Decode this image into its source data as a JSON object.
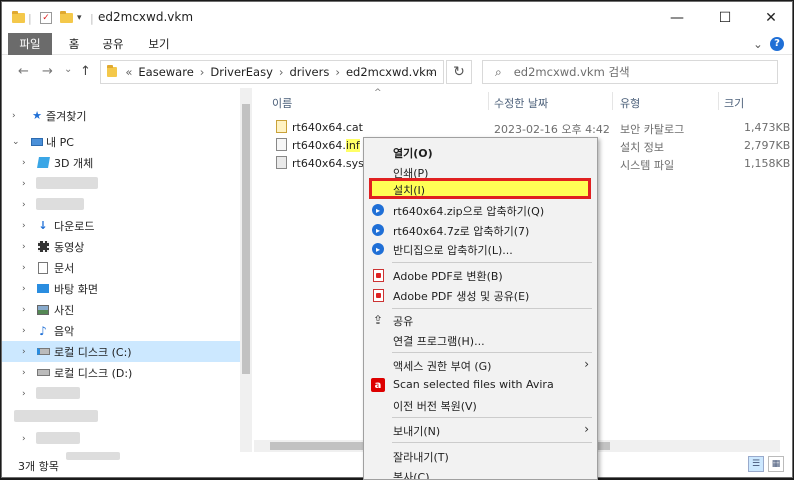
{
  "window": {
    "title": "ed2mcxwd.vkm",
    "minimize": "—",
    "maximize": "☐",
    "close": "✕",
    "help": "?"
  },
  "ribbon": {
    "tabs": [
      {
        "label": "파일"
      },
      {
        "label": "홈"
      },
      {
        "label": "공유"
      },
      {
        "label": "보기"
      }
    ],
    "expand": "⌄"
  },
  "nav": {
    "back": "←",
    "forward": "→",
    "recent": "⌄",
    "up": "↑",
    "breadcrumb": [
      "Easeware",
      "DriverEasy",
      "drivers",
      "ed2mcxwd.vkm"
    ],
    "overflow": "«",
    "refresh": "↻",
    "search_placeholder": "ed2mcxwd.vkm 검색"
  },
  "sidebar": {
    "items": [
      {
        "label": "즐겨찾기",
        "icon": "star-icon"
      },
      {
        "label": "내 PC",
        "icon": "pc-icon"
      },
      {
        "label": "3D 개체",
        "icon": "3d-objects-icon"
      },
      {
        "label": "다운로드",
        "icon": "download-icon"
      },
      {
        "label": "동영상",
        "icon": "video-icon"
      },
      {
        "label": "문서",
        "icon": "document-icon"
      },
      {
        "label": "바탕 화면",
        "icon": "desktop-icon"
      },
      {
        "label": "사진",
        "icon": "pictures-icon"
      },
      {
        "label": "음악",
        "icon": "music-icon"
      },
      {
        "label": "로컬 디스크 (C:)",
        "icon": "drive-c-icon"
      },
      {
        "label": "로컬 디스크 (D:)",
        "icon": "drive-d-icon"
      }
    ]
  },
  "columns": {
    "name": "이름",
    "modified": "수정한 날짜",
    "type": "유형",
    "size": "크기",
    "sort_indicator": "^"
  },
  "files": [
    {
      "name_base": "rt640x64.",
      "name_ext": "cat",
      "modified": "2023-02-16 오후 4:42",
      "type": "보안 카탈로그",
      "size": "1,473KB"
    },
    {
      "name_base": "rt640x64.",
      "name_ext": "inf",
      "modified": "",
      "type": "설치 정보",
      "size": "2,797KB"
    },
    {
      "name_base": "rt640x64.",
      "name_ext": "sys",
      "modified": "",
      "type": "시스템 파일",
      "size": "1,158KB"
    }
  ],
  "status": {
    "count": "3개 항목"
  },
  "context_menu": {
    "items": [
      {
        "label": "열기(O)"
      },
      {
        "label": "인쇄(P)"
      },
      {
        "label": "설치(I)"
      },
      {
        "label": "rt640x64.zip으로 압축하기(Q)"
      },
      {
        "label": "rt640x64.7z로 압축하기(7)"
      },
      {
        "label": "반디집으로 압축하기(L)..."
      },
      {
        "label": "Adobe PDF로 변환(B)"
      },
      {
        "label": "Adobe PDF 생성 및 공유(E)"
      },
      {
        "label": "공유"
      },
      {
        "label": "연결 프로그램(H)..."
      },
      {
        "label": "액세스 권한 부여 (G)"
      },
      {
        "label": "Scan selected files with Avira"
      },
      {
        "label": "이전 버전 복원(V)"
      },
      {
        "label": "보내기(N)"
      },
      {
        "label": "잘라내기(T)"
      },
      {
        "label": "복사(C)"
      }
    ]
  },
  "colors": {
    "highlight_yellow": "#ffff55",
    "highlight_border": "#e02020",
    "selected_row": "#cce8ff",
    "ribbon_file_tab": "#6b6b6b"
  }
}
